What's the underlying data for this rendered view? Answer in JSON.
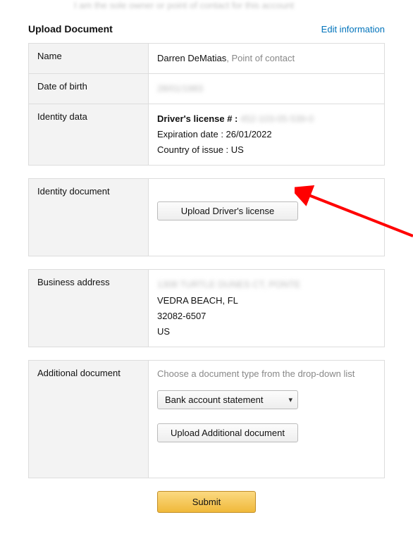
{
  "top_note": "I am the sole owner or point of contact for this account",
  "header": {
    "title": "Upload Document",
    "edit_link": "Edit information"
  },
  "info_table": {
    "name_label": "Name",
    "name_value": "Darren DeMatias",
    "name_role": ", Point of contact",
    "dob_label": "Date of birth",
    "dob_value_masked": "28/01/1983",
    "identity_label": "Identity data",
    "identity_license_label": "Driver's license # :",
    "identity_license_value_masked": "452-103-05-539-0",
    "identity_expiry": "Expiration date : 26/01/2022",
    "identity_country": "Country of issue : US"
  },
  "identity_doc": {
    "label": "Identity document",
    "button": "Upload Driver's license"
  },
  "business_address": {
    "label": "Business address",
    "line1_masked": "1308 TURTLE DUNES CT, PONTE",
    "line2": "VEDRA BEACH, FL",
    "line3": "32082-6507",
    "line4": "US"
  },
  "additional_doc": {
    "label": "Additional document",
    "prompt": "Choose a document type from the drop-down list",
    "select_value": "Bank account statement",
    "upload_button": "Upload Additional document"
  },
  "submit_button": "Submit"
}
